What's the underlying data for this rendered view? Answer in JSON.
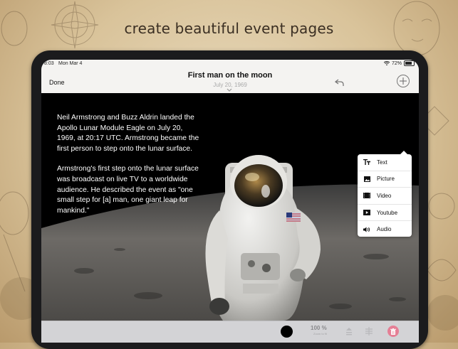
{
  "promo": {
    "headline": "create beautiful event pages"
  },
  "statusbar": {
    "time": "8:03",
    "date": "Mon Mar 4",
    "battery": "72%"
  },
  "navbar": {
    "done_label": "Done",
    "title": "First man on the moon",
    "subtitle": "July 20, 1969"
  },
  "story": {
    "paragraphs": [
      "Neil Armstrong and Buzz Aldrin landed the Apollo Lunar Module Eagle on July 20, 1969, at 20:17 UTC. Armstrong became the first person to step onto the lunar surface.",
      "Armstrong's first step onto the lunar surface was broadcast on live TV to a worldwide audience. He described the event as \"one small step for [a] man, one giant leap for mankind.\""
    ]
  },
  "add_menu": {
    "items": [
      {
        "label": "Text",
        "icon": "text-size-icon"
      },
      {
        "label": "Picture",
        "icon": "picture-icon"
      },
      {
        "label": "Video",
        "icon": "video-icon"
      },
      {
        "label": "Youtube",
        "icon": "youtube-icon"
      },
      {
        "label": "Audio",
        "icon": "audio-icon"
      }
    ]
  },
  "bottombar": {
    "zoom": "100 %",
    "zoom_caption": "Zoom to fit",
    "color": "#000000",
    "trash_color": "#e57f95"
  }
}
